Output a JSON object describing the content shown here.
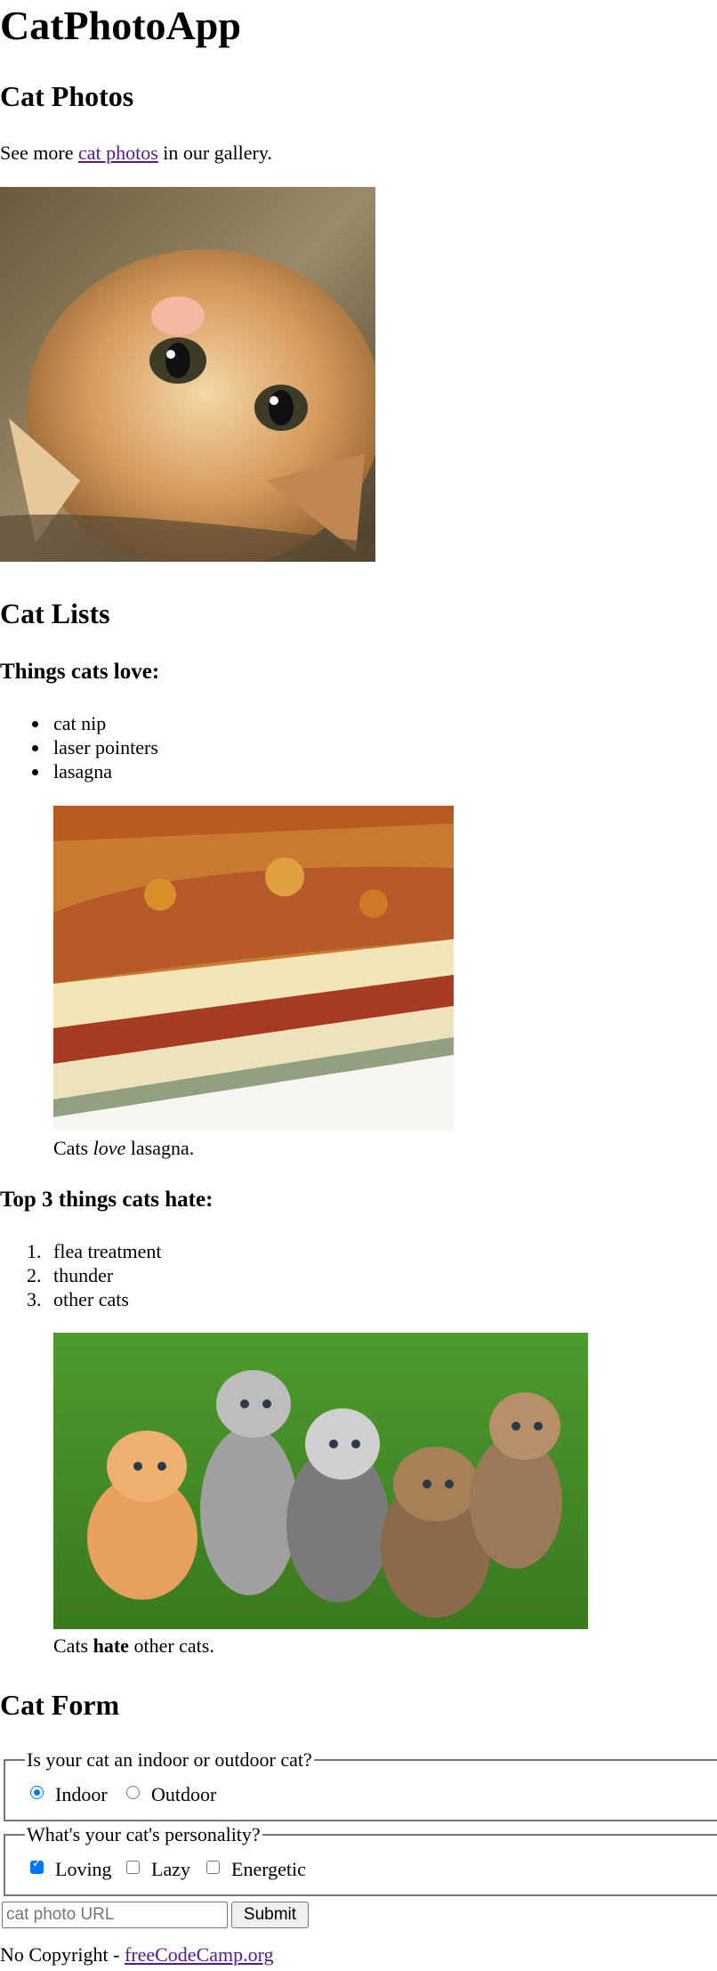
{
  "header": {
    "title": "CatPhotoApp"
  },
  "cat_photos": {
    "heading": "Cat Photos",
    "text_before": "See more ",
    "link_text": "cat photos",
    "text_after": " in our gallery."
  },
  "cat_lists": {
    "heading": "Cat Lists",
    "love": {
      "heading": "Things cats love:",
      "items": [
        "cat nip",
        "laser pointers",
        "lasagna"
      ],
      "caption": {
        "before": "Cats ",
        "emphasis": "love",
        "after": " lasagna."
      }
    },
    "hate": {
      "heading": "Top 3 things cats hate:",
      "items": [
        "flea treatment",
        "thunder",
        "other cats"
      ],
      "markers": [
        "1.",
        "2.",
        "3."
      ],
      "caption": {
        "before": "Cats ",
        "strong": "hate",
        "after": " other cats."
      }
    }
  },
  "cat_form": {
    "heading": "Cat Form",
    "location": {
      "legend": "Is your cat an indoor or outdoor cat?",
      "options": [
        "Indoor",
        "Outdoor"
      ],
      "selected": "Indoor"
    },
    "personality": {
      "legend": "What's your cat's personality?",
      "options": [
        "Loving",
        "Lazy",
        "Energetic"
      ],
      "checked": [
        "Loving"
      ]
    },
    "url_input": {
      "placeholder": "cat photo URL",
      "value": ""
    },
    "submit_label": "Submit"
  },
  "footer": {
    "text": "No Copyright - ",
    "link_text": "freeCodeCamp.org"
  },
  "icons": [
    "kitten-photo",
    "lasagna-photo",
    "kittens-photo"
  ],
  "colors": {
    "link": "#551a8b",
    "accent": "#0075ff",
    "border": "#767676"
  }
}
